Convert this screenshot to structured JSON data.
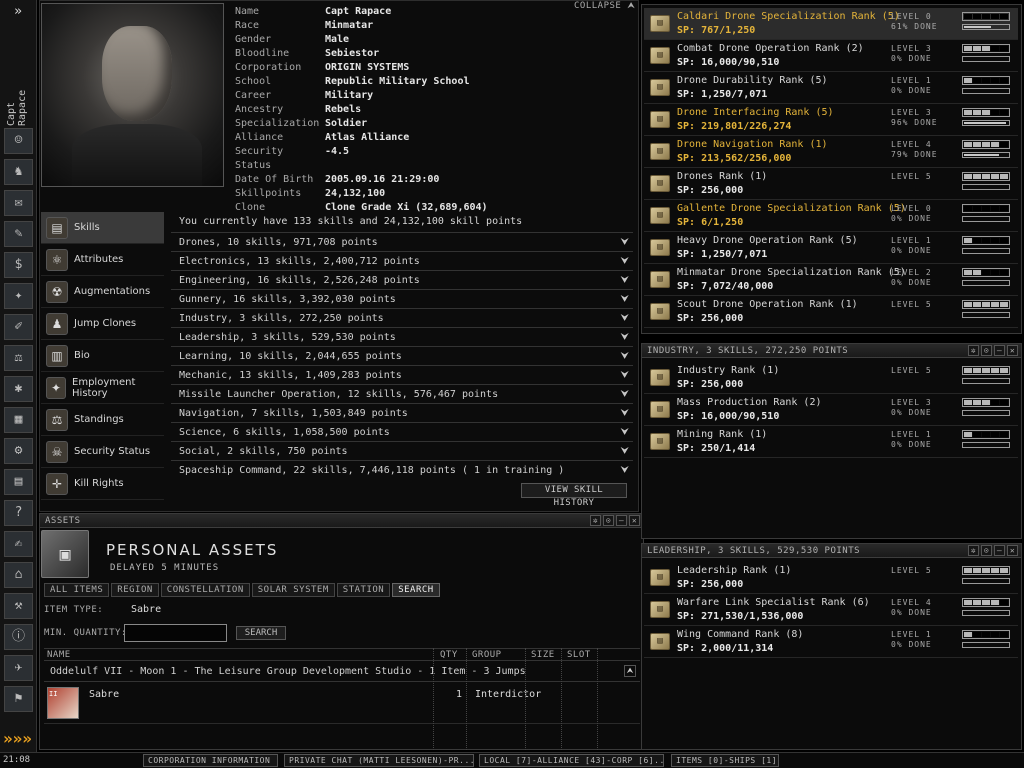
{
  "neocom": {
    "char_tag": "Capt Rapace",
    "clock": "21:08",
    "expand": "»",
    "arrow": "»»»",
    "icons": [
      "character-icon",
      "people-icon",
      "mail-icon",
      "notepad-icon",
      "wallet-icon",
      "map-icon",
      "journal-icon",
      "market-icon",
      "science-icon",
      "cargo-icon",
      "industry-icon",
      "calculator-icon",
      "help-icon",
      "contracts-icon",
      "corp-icon",
      "settings-icon",
      "info-icon",
      "ships-icon",
      "fitting-icon"
    ]
  },
  "character": {
    "collapse_label": "COLLAPSE",
    "fields": [
      {
        "k": "Name",
        "v": "Capt Rapace"
      },
      {
        "k": "Race",
        "v": "Minmatar"
      },
      {
        "k": "Gender",
        "v": "Male"
      },
      {
        "k": "Bloodline",
        "v": "Sebiestor"
      },
      {
        "k": "Corporation",
        "v": "ORIGIN SYSTEMS"
      },
      {
        "k": "School",
        "v": "Republic Military School"
      },
      {
        "k": "Career",
        "v": "Military"
      },
      {
        "k": "Ancestry",
        "v": "Rebels"
      },
      {
        "k": "Specialization",
        "v": "Soldier"
      },
      {
        "k": "Alliance",
        "v": "Atlas Alliance"
      },
      {
        "k": "Security Status",
        "v": "-4.5"
      },
      {
        "k": "Date Of Birth",
        "v": "2005.09.16  21:29:00"
      },
      {
        "k": "Skillpoints",
        "v": "24,132,100"
      },
      {
        "k": "Clone",
        "v": "Clone Grade Xi (32,689,604)"
      }
    ],
    "nav": [
      {
        "label": "Skills",
        "icon": "skills-icon",
        "sel": true
      },
      {
        "label": "Attributes",
        "icon": "attributes-icon"
      },
      {
        "label": "Augmentations",
        "icon": "augmentations-icon"
      },
      {
        "label": "Jump Clones",
        "icon": "jump-clones-icon"
      },
      {
        "label": "Bio",
        "icon": "bio-icon"
      },
      {
        "label": "Employment History",
        "icon": "employment-icon"
      },
      {
        "label": "Standings",
        "icon": "standings-icon"
      },
      {
        "label": "Security Status",
        "icon": "security-icon"
      },
      {
        "label": "Kill Rights",
        "icon": "kill-rights-icon"
      }
    ],
    "skills_summary": "You currently have 133 skills and 24,132,100 skill points",
    "skill_groups": [
      "Drones, 10 skills, 971,708 points",
      "Electronics, 13 skills, 2,400,712 points",
      "Engineering, 16 skills, 2,526,248 points",
      "Gunnery, 16 skills, 3,392,030 points",
      "Industry, 3 skills, 272,250 points",
      "Leadership, 3 skills, 529,530 points",
      "Learning, 10 skills, 2,044,655 points",
      "Mechanic, 13 skills, 1,409,283 points",
      "Missile Launcher Operation, 12 skills, 576,467 points",
      "Navigation, 7 skills, 1,503,849 points",
      "Science, 6 skills, 1,058,500 points",
      "Social, 2 skills, 750 points",
      "Spaceship Command, 22 skills, 7,446,118 points ( 1 in training )"
    ],
    "history_button": "VIEW SKILL HISTORY"
  },
  "assets": {
    "window_title": "ASSETS",
    "title": "PERSONAL ASSETS",
    "subtitle": "DELAYED 5 MINUTES",
    "tabs": [
      {
        "label": "ALL ITEMS"
      },
      {
        "label": "REGION"
      },
      {
        "label": "CONSTELLATION"
      },
      {
        "label": "SOLAR SYSTEM"
      },
      {
        "label": "STATION"
      },
      {
        "label": "SEARCH",
        "sel": true
      }
    ],
    "item_type_label": "ITEM TYPE:",
    "item_type_value": "Sabre",
    "min_qty_label": "MIN. QUANTITY:",
    "min_qty_value": "",
    "search_button": "SEARCH",
    "columns": {
      "name": "NAME",
      "qty": "QTY",
      "group": "GROUP",
      "size": "SIZE",
      "slot": "SLOT"
    },
    "location": "Oddelulf VII - Moon 1 - The Leisure Group Development Studio - 1 Item - 3 Jumps",
    "item": {
      "name": "Sabre",
      "qty": "1",
      "group": "Interdictor",
      "badge": "II"
    }
  },
  "drones_window": {
    "skills": [
      {
        "name": "Caldari Drone Specialization Rank (5)",
        "sp": "SP: 767/1,250",
        "level": "LEVEL 0",
        "done": "61% DONE",
        "lv": 0,
        "progress": 0.61,
        "gold": true,
        "hl": true
      },
      {
        "name": "Combat Drone Operation Rank (2)",
        "sp": "SP: 16,000/90,510",
        "level": "LEVEL 3",
        "done": "0% DONE",
        "lv": 3,
        "progress": 0.0
      },
      {
        "name": "Drone Durability Rank (5)",
        "sp": "SP: 1,250/7,071",
        "level": "LEVEL 1",
        "done": "0% DONE",
        "lv": 1,
        "progress": 0.0
      },
      {
        "name": "Drone Interfacing Rank (5)",
        "sp": "SP: 219,801/226,274",
        "level": "LEVEL 3",
        "done": "96% DONE",
        "lv": 3,
        "progress": 0.96,
        "gold": true
      },
      {
        "name": "Drone Navigation Rank (1)",
        "sp": "SP: 213,562/256,000",
        "level": "LEVEL 4",
        "done": "79% DONE",
        "lv": 4,
        "progress": 0.79,
        "gold": true
      },
      {
        "name": "Drones Rank (1)",
        "sp": "SP: 256,000",
        "level": "LEVEL 5",
        "done": "",
        "lv": 5,
        "progress": 0
      },
      {
        "name": "Gallente Drone Specialization Rank (5)",
        "sp": "SP: 6/1,250",
        "level": "LEVEL 0",
        "done": "0% DONE",
        "lv": 0,
        "progress": 0.0,
        "gold": true
      },
      {
        "name": "Heavy Drone Operation Rank (5)",
        "sp": "SP: 1,250/7,071",
        "level": "LEVEL 1",
        "done": "0% DONE",
        "lv": 1,
        "progress": 0.0
      },
      {
        "name": "Minmatar Drone Specialization Rank (5)",
        "sp": "SP: 7,072/40,000",
        "level": "LEVEL 2",
        "done": "0% DONE",
        "lv": 2,
        "progress": 0.0
      },
      {
        "name": "Scout Drone Operation Rank (1)",
        "sp": "SP: 256,000",
        "level": "LEVEL 5",
        "done": "",
        "lv": 5,
        "progress": 0
      }
    ]
  },
  "industry_window": {
    "title": "INDUSTRY, 3 SKILLS, 272,250 POINTS",
    "skills": [
      {
        "name": "Industry Rank (1)",
        "sp": "SP: 256,000",
        "level": "LEVEL 5",
        "done": "",
        "lv": 5,
        "progress": 0
      },
      {
        "name": "Mass Production Rank (2)",
        "sp": "SP: 16,000/90,510",
        "level": "LEVEL 3",
        "done": "0% DONE",
        "lv": 3,
        "progress": 0.0
      },
      {
        "name": "Mining Rank (1)",
        "sp": "SP: 250/1,414",
        "level": "LEVEL 1",
        "done": "0% DONE",
        "lv": 1,
        "progress": 0.0
      }
    ]
  },
  "leadership_window": {
    "title": "LEADERSHIP, 3 SKILLS, 529,530 POINTS",
    "skills": [
      {
        "name": "Leadership Rank (1)",
        "sp": "SP: 256,000",
        "level": "LEVEL 5",
        "done": "",
        "lv": 5,
        "progress": 0
      },
      {
        "name": "Warfare Link Specialist Rank (6)",
        "sp": "SP: 271,530/1,536,000",
        "level": "LEVEL 4",
        "done": "0% DONE",
        "lv": 4,
        "progress": 0.0
      },
      {
        "name": "Wing Command Rank (8)",
        "sp": "SP: 2,000/11,314",
        "level": "LEVEL 1",
        "done": "0% DONE",
        "lv": 1,
        "progress": 0.0
      }
    ]
  },
  "taskbar": [
    "CORPORATION INFORMATION",
    "PRIVATE CHAT (MATTI LEESONEN)-PR...",
    "LOCAL [7]-ALLIANCE [43]-CORP [6]...",
    "ITEMS [0]-SHIPS [1]"
  ],
  "colors": {
    "gold": "#e4b43a",
    "panel": "#0b0b0b",
    "border": "#3a3a3a"
  }
}
